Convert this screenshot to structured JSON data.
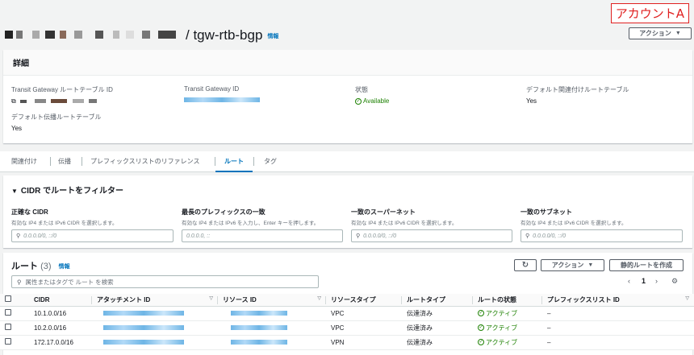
{
  "annotation": "アカウントA",
  "header": {
    "title": "/ tgw-rtb-bgp",
    "info": "情報",
    "action_label": "アクション"
  },
  "details": {
    "heading": "詳細",
    "fields": [
      {
        "label": "Transit Gateway ルートテーブル ID",
        "value": ""
      },
      {
        "label": "Transit Gateway ID",
        "value": ""
      },
      {
        "label": "状態",
        "value": "Available"
      },
      {
        "label": "デフォルト関連付けルートテーブル",
        "value": "Yes"
      },
      {
        "label": "デフォルト伝播ルートテーブル",
        "value": "Yes"
      }
    ]
  },
  "tabs": [
    "関連付け",
    "伝播",
    "プレフィックスリストのリファレンス",
    "ルート",
    "タグ"
  ],
  "active_tab": "ルート",
  "filter": {
    "heading": "CIDR でルートをフィルター",
    "columns": [
      {
        "label": "正確な CIDR",
        "desc": "有効な IP4 または IPv6 CIDR を選択します。",
        "placeholder": "0.0.0.0/0, ::/0"
      },
      {
        "label": "最長のプレフィックスの一致",
        "desc": "有効な IP4 または IPv6 を入力し、Enter キーを押します。",
        "placeholder": "0.0.0.0, ::"
      },
      {
        "label": "一致のスーパーネット",
        "desc": "有効な IP4 または IPv6 CIDR を選択します。",
        "placeholder": "0.0.0.0/0, ::/0"
      },
      {
        "label": "一致のサブネット",
        "desc": "有効な IP4 または IPv6 CIDR を選択します。",
        "placeholder": "0.0.0.0/0, ::/0"
      }
    ]
  },
  "routes": {
    "title": "ルート",
    "count": "(3)",
    "info": "情報",
    "search_placeholder": "属性またはタグで ルート を検索",
    "action_label": "アクション",
    "create_static_label": "静的ルートを作成",
    "page": "1",
    "columns": [
      "CIDR",
      "アタッチメント ID",
      "リソース ID",
      "リソースタイプ",
      "ルートタイプ",
      "ルートの状態",
      "プレフィックスリスト ID"
    ],
    "rows": [
      {
        "cidr": "10.1.0.0/16",
        "resource_type": "VPC",
        "route_type": "伝達済み",
        "state": "アクティブ",
        "prefix": "–"
      },
      {
        "cidr": "10.2.0.0/16",
        "resource_type": "VPC",
        "route_type": "伝達済み",
        "state": "アクティブ",
        "prefix": "–"
      },
      {
        "cidr": "172.17.0.0/16",
        "resource_type": "VPN",
        "route_type": "伝達済み",
        "state": "アクティブ",
        "prefix": "–"
      }
    ]
  },
  "colors": {
    "accent": "#0073bb",
    "success": "#1d8102",
    "annotation": "#e02020"
  }
}
